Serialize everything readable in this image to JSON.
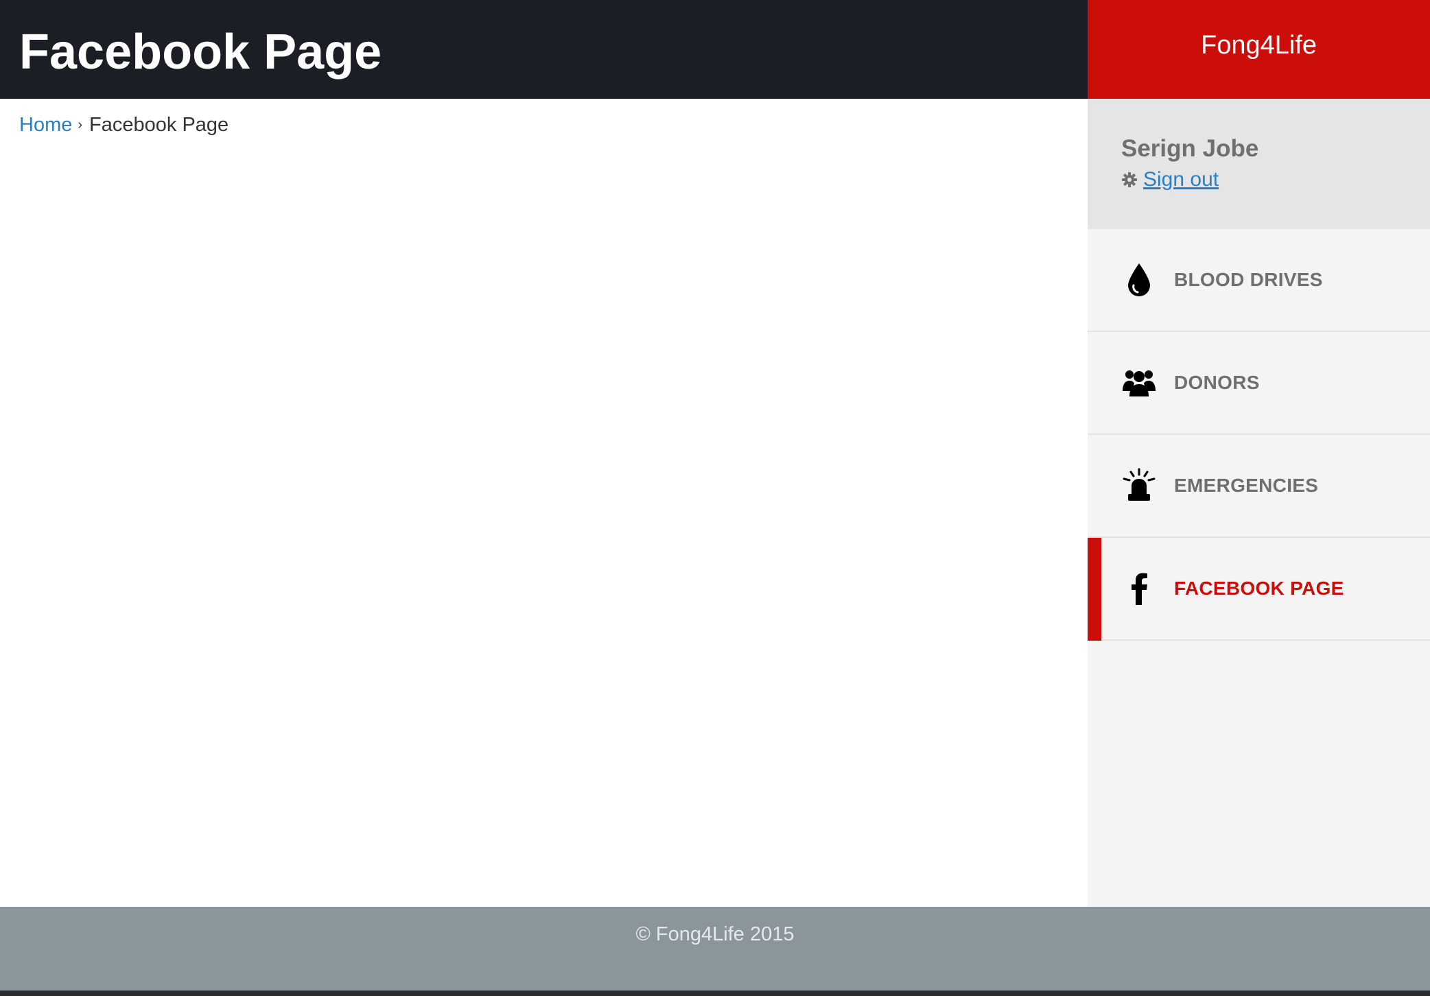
{
  "header": {
    "title": "Facebook Page",
    "brand": "Fong4Life"
  },
  "breadcrumb": {
    "home": "Home",
    "separator": "›",
    "current": "Facebook Page"
  },
  "user": {
    "name": "Serign Jobe",
    "signout_label": "Sign out"
  },
  "sidebar": {
    "items": [
      {
        "label": "BLOOD DRIVES",
        "icon": "blood-drop-icon",
        "active": false
      },
      {
        "label": "DONORS",
        "icon": "people-icon",
        "active": false
      },
      {
        "label": "EMERGENCIES",
        "icon": "siren-icon",
        "active": false
      },
      {
        "label": "FACEBOOK PAGE",
        "icon": "facebook-icon",
        "active": true
      }
    ]
  },
  "footer": {
    "text": "© Fong4Life 2015"
  },
  "colors": {
    "header_bg": "#1c1e25",
    "brand_red": "#cc0e0a",
    "link_blue": "#2a7fc3",
    "sidebar_bg": "#f4f4f4",
    "user_panel_bg": "#e5e5e5",
    "footer_bg": "#8a959c"
  }
}
